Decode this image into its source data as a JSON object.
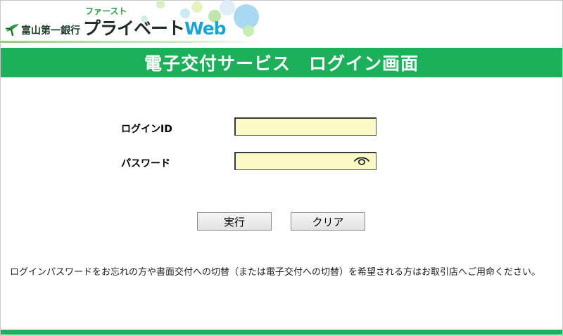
{
  "brand": {
    "bank_name": "富山第一銀行",
    "service_small": "ファースト",
    "service_main": "プライベート",
    "service_web": "Web",
    "logo_icon": "bank-leaf-logo",
    "accent_color": "#1db05a"
  },
  "title": {
    "text": "電子交付サービス　ログイン画面"
  },
  "form": {
    "login_id_label": "ログインID",
    "login_id_value": "",
    "password_label": "パスワード",
    "password_value": "",
    "show_password_icon": "eye-icon",
    "input_bg": "#fbfac7"
  },
  "buttons": {
    "execute": "実行",
    "clear": "クリア"
  },
  "notice": {
    "text": "ログインパスワードをお忘れの方や書面交付への切替（または電子交付への切替）を希望される方はお取引店へご用命ください。"
  }
}
